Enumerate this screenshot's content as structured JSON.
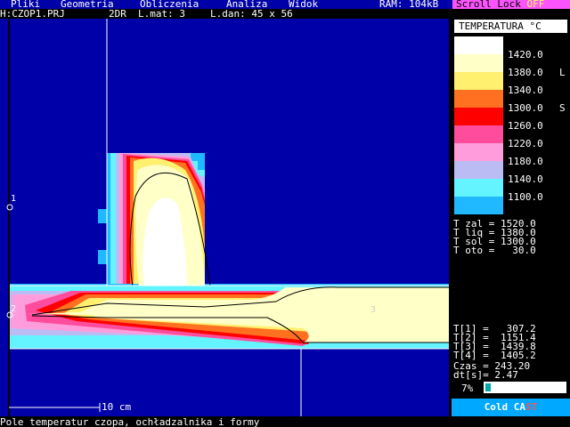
{
  "menu": {
    "items": [
      "Pliki",
      "Geometria",
      "Obliczenia",
      "Analiza",
      "Widok"
    ],
    "ram_label": "RAM: 104kB",
    "scroll_lock_label": "Scroll Lock ",
    "scroll_lock_state": "OFF"
  },
  "info": {
    "project": "H:CZOP1.PRJ",
    "mode": "2DR",
    "materials": "L.mat: 3",
    "grid": "L.dan: 45 x 56"
  },
  "drawing": {
    "node_labels": [
      "1",
      "2",
      "3"
    ],
    "scale_label": "10 cm"
  },
  "legend": {
    "title": "TEMPERATURA °C",
    "bands": [
      {
        "color": "#ffffff",
        "value": "1420.0",
        "mark": ""
      },
      {
        "color": "#ffffc8",
        "value": "1380.0",
        "mark": "L"
      },
      {
        "color": "#fff070",
        "value": "1340.0",
        "mark": ""
      },
      {
        "color": "#ff7020",
        "value": "1300.0",
        "mark": "S"
      },
      {
        "color": "#ff0000",
        "value": "1260.0",
        "mark": ""
      },
      {
        "color": "#ff4c9c",
        "value": "1220.0",
        "mark": ""
      },
      {
        "color": "#ff9cdc",
        "value": "1180.0",
        "mark": ""
      },
      {
        "color": "#bcbcf4",
        "value": "1140.0",
        "mark": ""
      },
      {
        "color": "#64f4ff",
        "value": "1100.0",
        "mark": ""
      },
      {
        "color": "#20b8ff",
        "value": "",
        "mark": ""
      }
    ]
  },
  "params": [
    "T zal = 1520.0",
    "T liq = 1380.0",
    "T sol = 1300.0",
    "T oto =   30.0"
  ],
  "results": [
    "T[1] =   307.2",
    "T[2] =  1151.4",
    "T[3] =  1439.8",
    "T[4] =  1405.2",
    "Czas = 243.20",
    "dt[s]= 2.47"
  ],
  "progress": {
    "label": "7%",
    "value": 0.07
  },
  "brand": {
    "part1": "Cold CA",
    "accent": "ST"
  },
  "status": "Pole temperatur czopa, ochładzalnika i formy",
  "colors": {
    "background": "#0000a8",
    "accent": "#fc54fc"
  }
}
